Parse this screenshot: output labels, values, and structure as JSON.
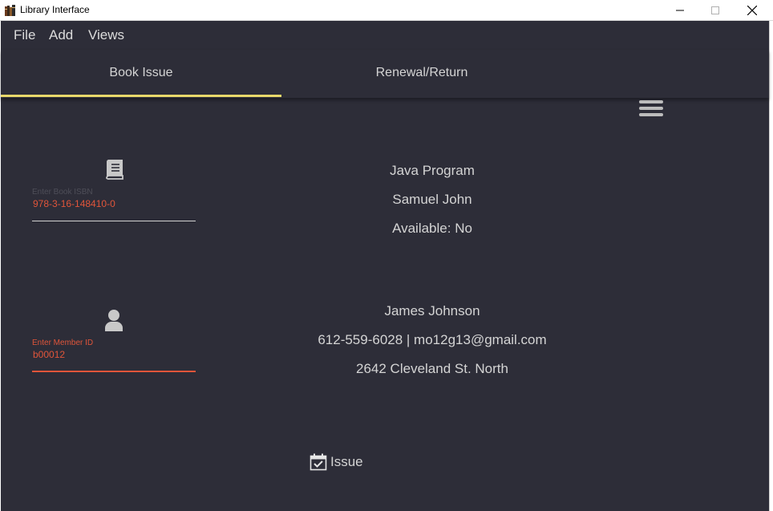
{
  "window": {
    "title": "Library Interface"
  },
  "menu": {
    "items": [
      "File",
      "Add",
      "Views"
    ]
  },
  "tabs": [
    {
      "label": "Book Issue",
      "active": true
    },
    {
      "label": "Renewal/Return",
      "active": false
    }
  ],
  "book": {
    "isbn_label": "Enter Book ISBN",
    "isbn_value": "978-3-16-148410-0",
    "title": "Java Program",
    "author": "Samuel John",
    "availability": "Available: No"
  },
  "member": {
    "id_label": "Enter Member ID",
    "id_value": "b00012",
    "name": "James Johnson",
    "contact": "612-559-6028 | mo12g13@gmail.com",
    "address": "2642 Cleveland St. North"
  },
  "actions": {
    "issue_label": "Issue"
  },
  "colors": {
    "background": "#2d2d38",
    "accent_tab": "#e8d86a",
    "input_text": "#e0553a",
    "text": "#d4d4d4",
    "icon": "#c8c8c8"
  },
  "icons": {
    "app": "books-icon",
    "book": "book-icon",
    "member": "user-icon",
    "issue": "calendar-check-icon",
    "menu": "hamburger-icon"
  }
}
